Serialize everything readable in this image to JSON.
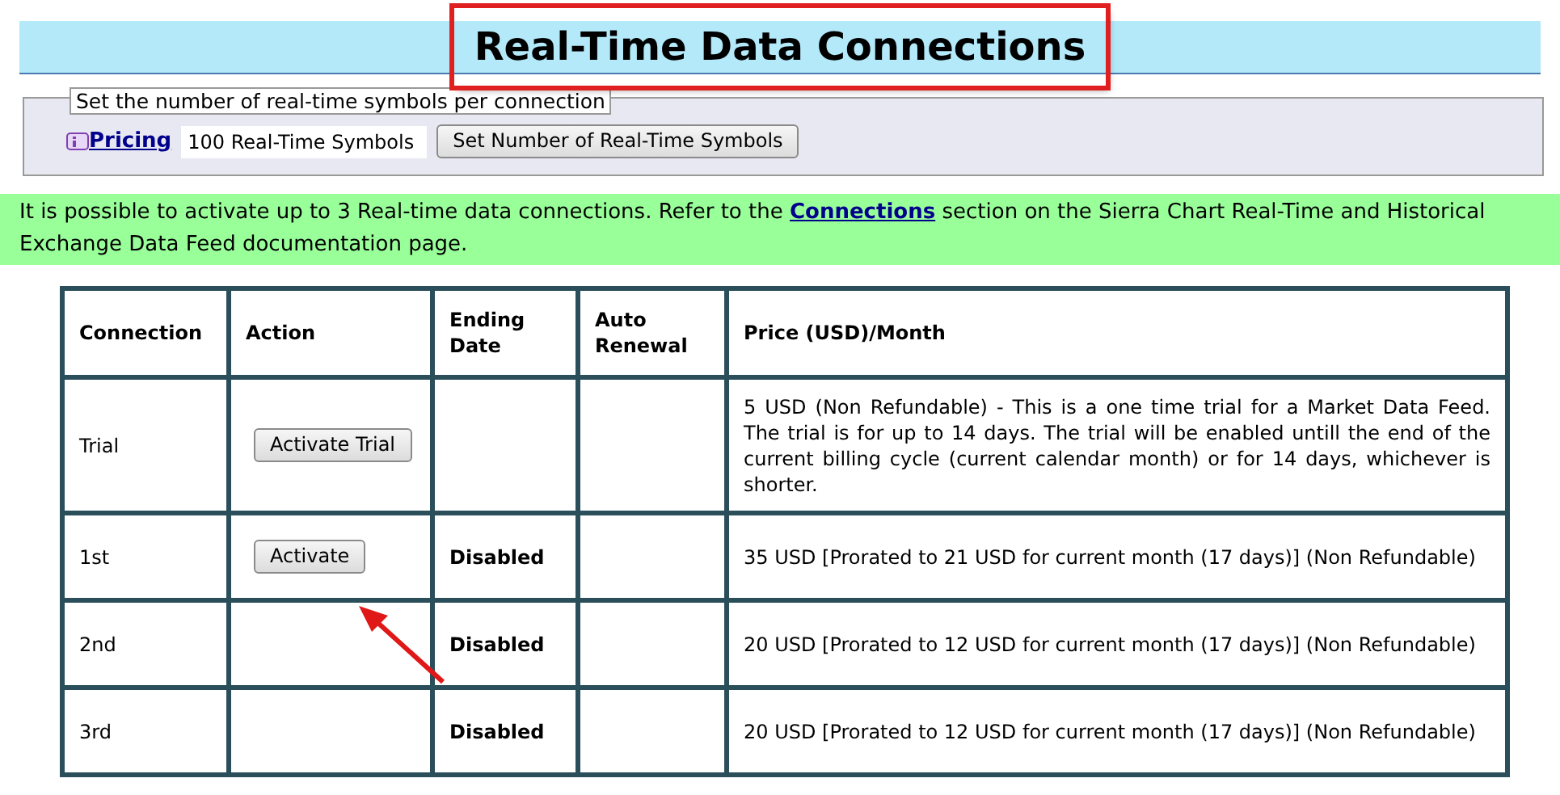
{
  "title": "Real-Time Data Connections",
  "symbols_panel": {
    "legend": "Set the number of real-time symbols per connection",
    "link": "Pricing",
    "field_value": "100 Real-Time Symbols",
    "button": "Set Number of Real-Time Symbols"
  },
  "notice": {
    "before": "It is possible to activate up to 3 Real-time data connections. Refer to the ",
    "link": "Connections",
    "after": " section on the Sierra Chart Real-Time and Historical Exchange Data Feed documentation page."
  },
  "table": {
    "columns": [
      "Connection",
      "Action",
      "Ending Date",
      "Auto Renewal",
      "Price (USD)/Month"
    ],
    "rows": [
      {
        "connection": "Trial",
        "action": "Activate Trial",
        "price": "5 USD (Non Refundable) - This is a one time trial for a Market Data Feed. The trial is for up to 14 days. The trial will be enabled untill the end of the current billing cycle (current calendar month) or for 14 days, whichever is shorter."
      },
      {
        "connection": "1st",
        "action": "Activate",
        "ending_date": "Disabled",
        "price": "35 USD [Prorated to 21 USD for current month (17 days)] (Non Refundable)"
      },
      {
        "connection": "2nd",
        "ending_date": "Disabled",
        "price": "20 USD [Prorated to 12 USD for current month (17 days)] (Non Refundable)"
      },
      {
        "connection": "3rd",
        "ending_date": "Disabled",
        "price": "20 USD [Prorated to 12 USD for current month (17 days)] (Non Refundable)"
      }
    ]
  }
}
